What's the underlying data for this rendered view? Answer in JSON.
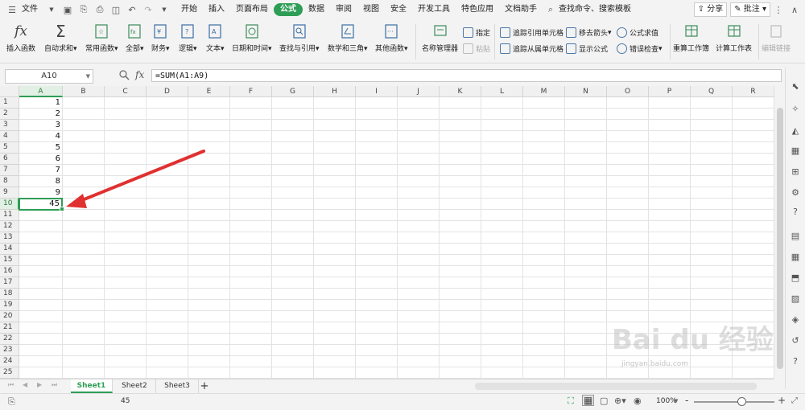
{
  "menu": {
    "file": "文件",
    "tabs": [
      "开始",
      "插入",
      "页面布局",
      "公式",
      "数据",
      "审阅",
      "视图",
      "安全",
      "开发工具",
      "特色应用",
      "文档助手"
    ],
    "active_tab": "公式",
    "search": "查找命令、搜索模板",
    "share": "分享",
    "comment": "批注"
  },
  "ribbon": {
    "insert_function": "插入函数",
    "autosum": "自动求和",
    "common": "常用函数",
    "all": "全部",
    "finance": "财务",
    "logic": "逻辑",
    "text": "文本",
    "datetime": "日期和时间",
    "lookup": "查找与引用",
    "math": "数学和三角",
    "other": "其他函数",
    "name_manager": "名称管理器",
    "specify": "指定",
    "paste": "粘贴",
    "trace_precedents": "追踪引用单元格",
    "trace_dependents": "追踪从属单元格",
    "remove_arrows": "移去箭头",
    "show_formulas": "显示公式",
    "evaluate": "公式求值",
    "error_check": "错误检查",
    "recalc_book": "重算工作簿",
    "calc_sheet": "计算工作表",
    "edit_links": "编辑链接"
  },
  "formula_bar": {
    "name_box": "A10",
    "fx": "fx",
    "formula": "=SUM(A1:A9)"
  },
  "grid": {
    "columns": [
      "A",
      "B",
      "C",
      "D",
      "E",
      "F",
      "G",
      "H",
      "I",
      "J",
      "K",
      "L",
      "M",
      "N",
      "O",
      "P",
      "Q",
      "R"
    ],
    "rows": [
      "1",
      "2",
      "3",
      "4",
      "5",
      "6",
      "7",
      "8",
      "9",
      "10",
      "11",
      "12",
      "13",
      "14",
      "15",
      "16",
      "17",
      "18",
      "19",
      "20",
      "21",
      "22",
      "23",
      "24",
      "25"
    ],
    "a_values": [
      "1",
      "2",
      "3",
      "4",
      "5",
      "6",
      "7",
      "8",
      "9",
      "45"
    ],
    "selected_cell": "A10"
  },
  "sheets": [
    "Sheet1",
    "Sheet2",
    "Sheet3"
  ],
  "add_sheet": "+",
  "status": {
    "sum_value": "45",
    "zoom": "100%",
    "zoom_minus": "-",
    "zoom_plus": "+"
  },
  "watermark": {
    "brand": "Bai du 经验",
    "url": "jingyan.baidu.com"
  }
}
